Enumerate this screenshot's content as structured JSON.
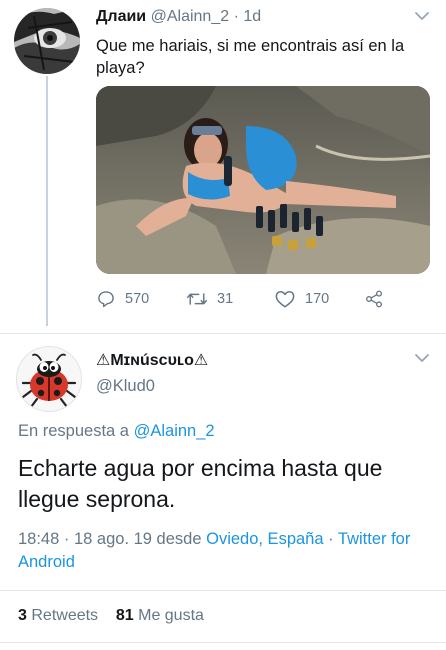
{
  "reply_to_tweet": {
    "display_name": "Длаии",
    "handle": "@Alainn_2",
    "separator": "·",
    "age": "1d",
    "text": "Que me hariais, si me encontrais así en la playa?",
    "replies": "570",
    "retweets": "31",
    "likes": "170"
  },
  "focused_tweet": {
    "display_name": "⚠Mɪɴúsᴄᴜʟᴏ⚠",
    "handle": "@Klud0",
    "replying_prefix": "En respuesta a",
    "replying_handle": "@Alainn_2",
    "text": "Echarte agua por encima hasta que llegue seprona.",
    "time": "18:48",
    "date_sep": "·",
    "date": "18 ago. 19 desde",
    "location": "Oviedo, España",
    "client_sep": "·",
    "client": "Twitter for Android",
    "retweet_count": "3",
    "retweet_label": "Retweets",
    "like_count": "81",
    "like_label": "Me gusta"
  },
  "colors": {
    "link": "#1b95e0",
    "secondary_text": "#657786",
    "primary_text": "#14171a",
    "thread_line": "#c5d3de"
  },
  "icons": [
    "reply-icon",
    "retweet-icon",
    "like-icon",
    "share-icon",
    "chevron-down-icon"
  ]
}
